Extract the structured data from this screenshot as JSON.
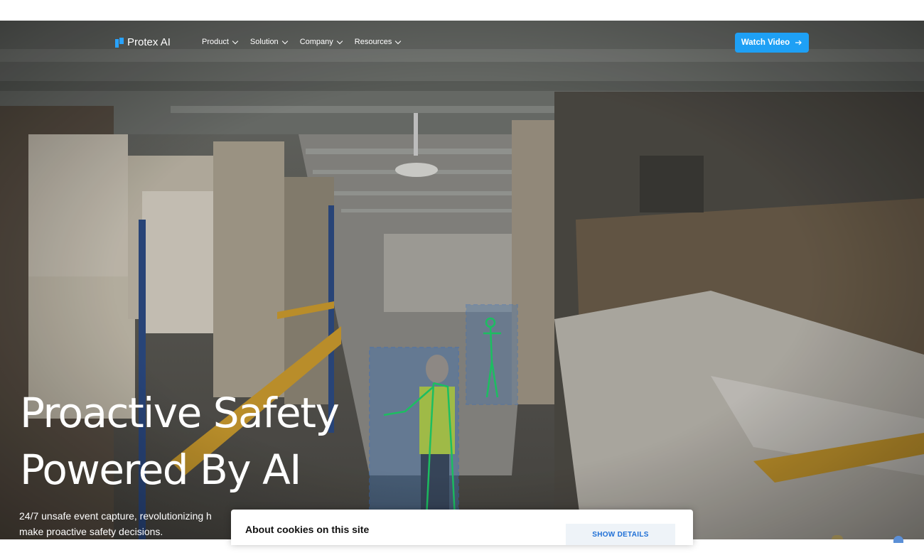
{
  "nav": {
    "logo_text": "Protex AI",
    "menu": [
      {
        "label": "Product"
      },
      {
        "label": "Solution"
      },
      {
        "label": "Company"
      },
      {
        "label": "Resources"
      }
    ],
    "cta_label": "Watch Video"
  },
  "hero": {
    "headline_line1": "Proactive Safety",
    "headline_line2": "Powered By AI",
    "subtext": "24/7 unsafe event capture, revolutionizing h",
    "subtext_line2": "make proactive safety decisions."
  },
  "cookie_banner": {
    "title": "About cookies on this site",
    "show_details_label": "SHOW DETAILS"
  },
  "colors": {
    "accent": "#1ea0f5",
    "logo_mark": "#29a3ff",
    "cookie_button_text": "#1e6fd6"
  },
  "icons": {
    "dropdown": "chevron-down-icon",
    "cta": "arrow-right-icon",
    "logo": "protex-logo-mark-icon"
  }
}
